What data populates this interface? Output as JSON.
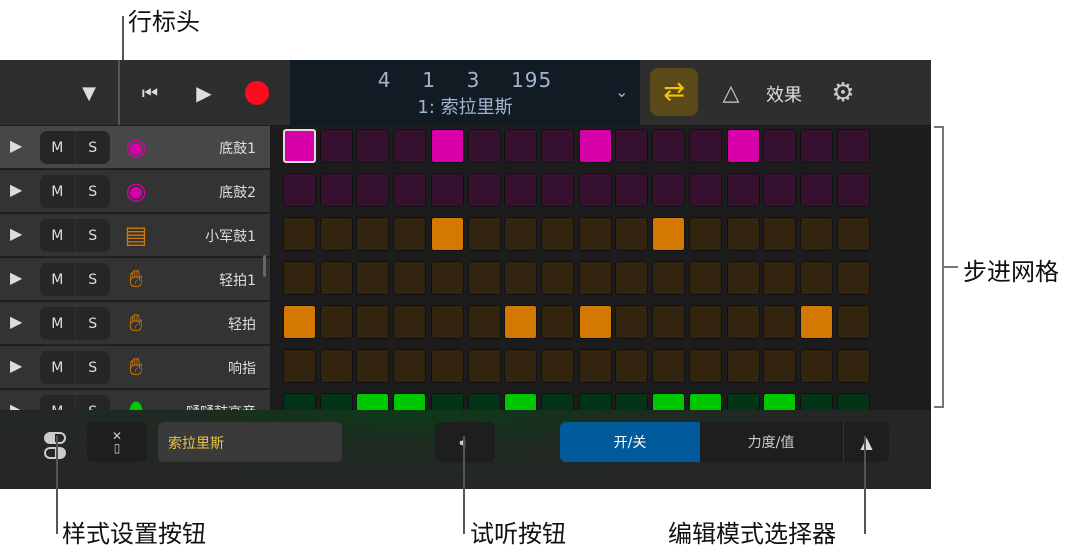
{
  "callouts": {
    "row_header": "行标头",
    "step_grid": "步进网格",
    "style_settings": "样式设置按钮",
    "preview": "试听按钮",
    "edit_mode": "编辑模式选择器"
  },
  "transport": {
    "position": "4  1  3  195",
    "pattern_name": "1: 索拉里斯",
    "effects_label": "效果"
  },
  "colors": {
    "magenta": "#d800a8",
    "orange": "#d37800",
    "green": "#00c800"
  },
  "rows": [
    {
      "name": "底鼓1",
      "icon": "kick-drum-icon",
      "color": "magenta",
      "steps": [
        1,
        5,
        9,
        13
      ],
      "selected": true
    },
    {
      "name": "底鼓2",
      "icon": "kick-drum-icon",
      "color": "magenta",
      "steps": []
    },
    {
      "name": "小军鼓1",
      "icon": "snare-drum-icon",
      "color": "orange",
      "steps": [
        5,
        11
      ]
    },
    {
      "name": "轻拍1",
      "icon": "hand-clap-icon",
      "color": "orange",
      "steps": []
    },
    {
      "name": "轻拍",
      "icon": "hand-clap-icon",
      "color": "orange",
      "steps": [
        1,
        7,
        9,
        15
      ]
    },
    {
      "name": "响指",
      "icon": "hand-clap-icon",
      "color": "orange",
      "steps": []
    },
    {
      "name": "嗵嗵鼓高音",
      "icon": "tom-drum-icon",
      "color": "green",
      "steps": [
        3,
        4,
        7,
        11,
        12,
        14
      ]
    }
  ],
  "row_buttons": {
    "mute": "M",
    "solo": "S"
  },
  "bottom": {
    "pattern_field": "索拉里斯",
    "mode_on_off": "开/关",
    "mode_velocity": "力度/值"
  }
}
